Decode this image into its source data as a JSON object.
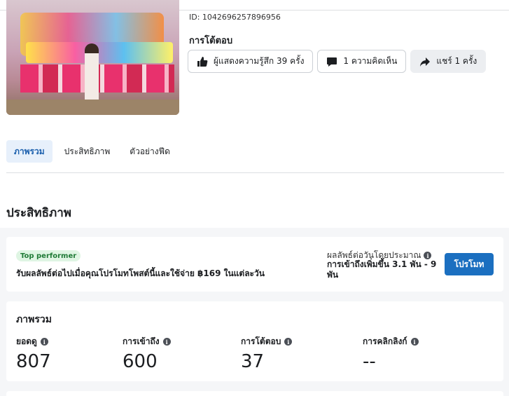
{
  "post": {
    "id_text": "ID: 1042696257896956",
    "reactions_title": "การโต้ตอบ",
    "reactions_button": "ผู้แสดงความรู้สึก 39 ครั้ง",
    "comments_button": "1 ความคิดเห็น",
    "shares_button": "แชร์ 1 ครั้ง"
  },
  "tabs": [
    {
      "label": "ภาพรวม",
      "active": true
    },
    {
      "label": "ประสิทธิภาพ",
      "active": false
    },
    {
      "label": "ตัวอย่างฟีด",
      "active": false
    }
  ],
  "section_title": "ประสิทธิภาพ",
  "promo": {
    "badge": "Top performer",
    "text": "รับผลลัพธ์ต่อไปเมื่อคุณโปรโมทโพสต์นี้และใช้จ่าย ฿169 ในแต่ละวัน",
    "est_label": "ผลลัพธ์ต่อวันโดยประมาณ",
    "est_value": "การเข้าถึงเพิ่มขึ้น 3.1 พัน - 9 พัน",
    "button": "โปรโมท"
  },
  "overview": {
    "title": "ภาพรวม",
    "metrics": [
      {
        "label": "ยอดดู",
        "value": "807"
      },
      {
        "label": "การเข้าถึง",
        "value": "600"
      },
      {
        "label": "การโต้ตอบ",
        "value": "37"
      },
      {
        "label": "การคลิกลิงก์",
        "value": "--"
      }
    ]
  },
  "colors": {
    "accent": "#1b6fc0",
    "badge_bg": "#dff5e3",
    "badge_text": "#1f7a36",
    "tab_active_bg": "#e7f0fb"
  },
  "icons": [
    "thumbs-up-icon",
    "comment-icon",
    "share-icon",
    "info-icon"
  ]
}
